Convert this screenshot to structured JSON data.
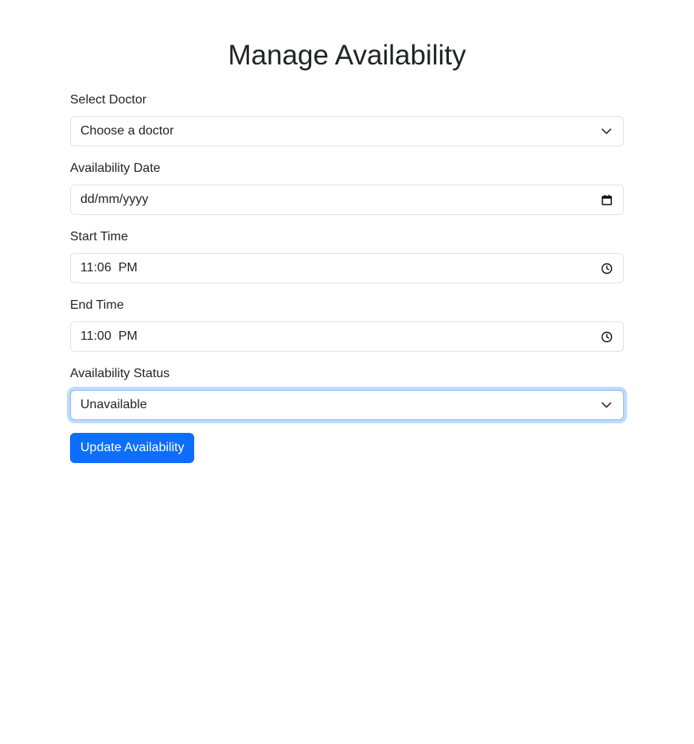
{
  "page": {
    "title": "Manage Availability"
  },
  "form": {
    "doctor": {
      "label": "Select Doctor",
      "value": "Choose a doctor",
      "icon": "chevron-down-icon"
    },
    "date": {
      "label": "Availability Date",
      "value": "dd/mm/yyyy",
      "icon": "calendar-icon"
    },
    "start_time": {
      "label": "Start Time",
      "value": "11:06  PM",
      "icon": "clock-icon"
    },
    "end_time": {
      "label": "End Time",
      "value": "11:00  PM",
      "icon": "clock-icon"
    },
    "status": {
      "label": "Availability Status",
      "value": "Unavailable",
      "icon": "chevron-down-icon"
    },
    "submit_label": "Update Availability"
  },
  "colors": {
    "primary": "#0d6efd",
    "text": "#212529",
    "border": "#dee2e6",
    "focus_border": "#86b7fe"
  }
}
